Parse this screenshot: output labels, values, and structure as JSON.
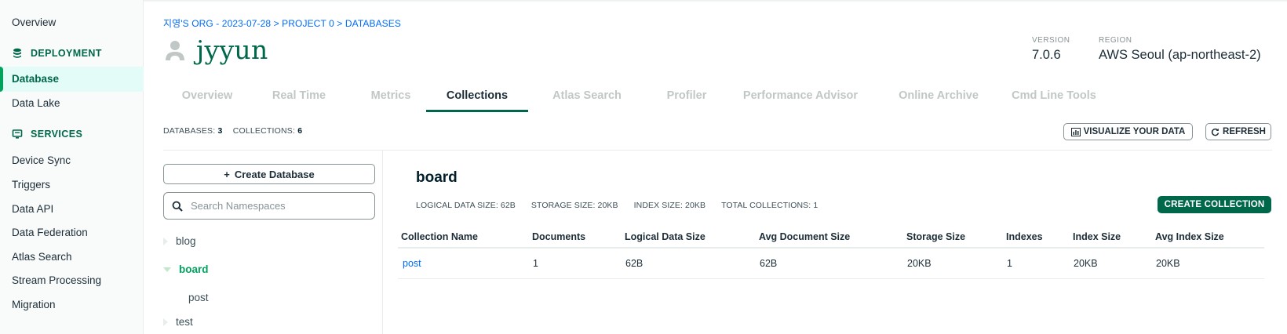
{
  "sidebar": {
    "overview": "Overview",
    "deployment_section": "DEPLOYMENT",
    "database": "Database",
    "data_lake": "Data Lake",
    "services_section": "SERVICES",
    "items": [
      "Device Sync",
      "Triggers",
      "Data API",
      "Data Federation",
      "Atlas Search",
      "Stream Processing",
      "Migration"
    ]
  },
  "header": {
    "breadcrumb": "지영'S ORG - 2023-07-28 > PROJECT 0 > DATABASES",
    "title": "jyyun",
    "version_label": "VERSION",
    "version_value": "7.0.6",
    "region_label": "REGION",
    "region_value": "AWS Seoul (ap-northeast-2)"
  },
  "tabs": [
    "Overview",
    "Real Time",
    "Metrics",
    "Collections",
    "Atlas Search",
    "Profiler",
    "Performance Advisor",
    "Online Archive",
    "Cmd Line Tools"
  ],
  "active_tab": "Collections",
  "stats": {
    "databases_label": "DATABASES:",
    "databases_value": "3",
    "collections_label": "COLLECTIONS:",
    "collections_value": "6"
  },
  "toolbar": {
    "visualize_label": "VISUALIZE YOUR DATA",
    "refresh_label": "REFRESH"
  },
  "namespace_panel": {
    "create_db_label": "Create Database",
    "search_placeholder": "Search Namespaces",
    "databases": [
      {
        "name": "blog",
        "expanded": false
      },
      {
        "name": "board",
        "expanded": true,
        "collections": [
          "post"
        ]
      },
      {
        "name": "test",
        "expanded": false
      }
    ]
  },
  "db_panel": {
    "title": "board",
    "logical_data_size": "LOGICAL DATA SIZE: 62B",
    "storage_size": "STORAGE SIZE: 20KB",
    "index_size": "INDEX SIZE: 20KB",
    "total_collections": "TOTAL COLLECTIONS: 1",
    "create_collection_label": "CREATE COLLECTION"
  },
  "table": {
    "columns": [
      "Collection Name",
      "Documents",
      "Logical Data Size",
      "Avg Document Size",
      "Storage Size",
      "Indexes",
      "Index Size",
      "Avg Index Size"
    ],
    "rows": [
      [
        "post",
        "1",
        "62B",
        "62B",
        "20KB",
        "1",
        "20KB",
        "20KB"
      ]
    ]
  },
  "colors": {
    "brand_green": "#00684a",
    "accent_green": "#00a35c",
    "link_blue": "#016bf8"
  }
}
